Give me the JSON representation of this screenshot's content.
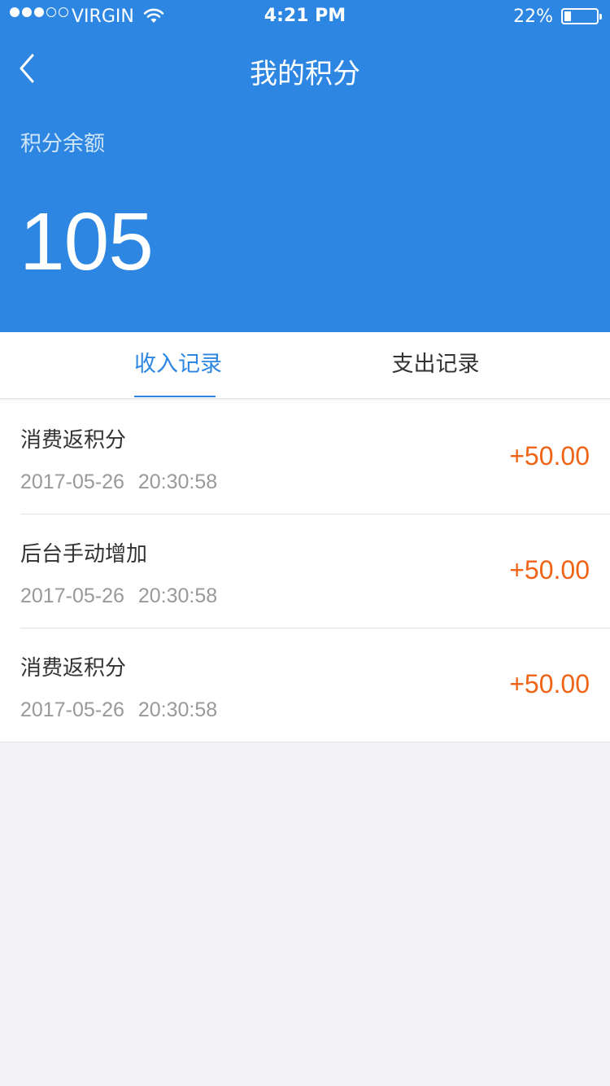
{
  "status_bar": {
    "carrier": "VIRGIN",
    "time": "4:21 PM",
    "battery_percent": "22%",
    "battery_level": 0.22,
    "signal_bars_filled": 3,
    "signal_bars_total": 5
  },
  "nav": {
    "title": "我的积分",
    "back_icon": "chevron-left-icon"
  },
  "balance": {
    "label": "积分余额",
    "value": "105"
  },
  "tabs": [
    {
      "label": "收入记录",
      "active": true
    },
    {
      "label": "支出记录",
      "active": false
    }
  ],
  "records": [
    {
      "title": "消费返积分",
      "time": "2017-05-26 20:30:58",
      "amount": "+50.00"
    },
    {
      "title": "后台手动增加",
      "time": "2017-05-26 20:30:58",
      "amount": "+50.00"
    },
    {
      "title": "消费返积分",
      "time": "2017-05-26 20:30:58",
      "amount": "+50.00"
    }
  ],
  "colors": {
    "primary": "#2d87e2",
    "amount": "#f06418",
    "background": "#f3f3f8"
  }
}
